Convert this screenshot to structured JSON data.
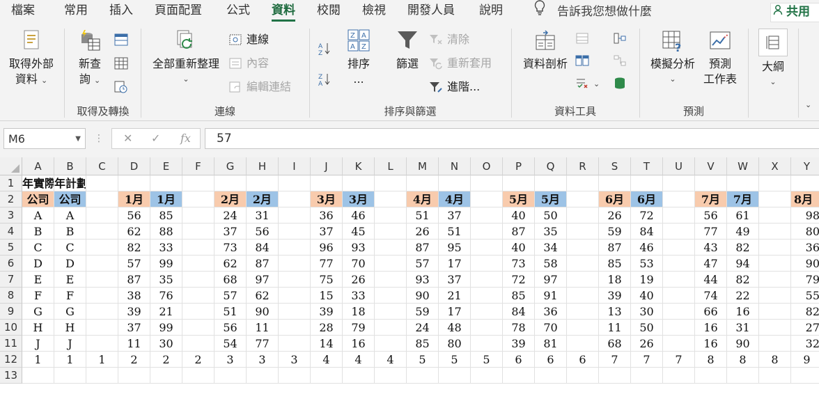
{
  "tabs": [
    "檔案",
    "常用",
    "插入",
    "頁面配置",
    "公式",
    "資料",
    "校閱",
    "檢視",
    "開發人員",
    "說明"
  ],
  "active_tab": "資料",
  "tell_me": "告訴我您想做什麼",
  "share_label": "共用",
  "ribbon": {
    "get_external": {
      "line1": "取得外部",
      "line2": "資料"
    },
    "new_query": {
      "line1": "新查",
      "line2": "詢"
    },
    "group_get_transform": "取得及轉換",
    "refresh_all": "全部重新整理",
    "connections": "連線",
    "properties": "內容",
    "edit_links": "編輯連結",
    "group_connections": "連線",
    "sort": "排序",
    "sort_more": "...",
    "filter": "篩選",
    "clear": "清除",
    "reapply": "重新套用",
    "advanced": "進階...",
    "group_sort_filter": "排序與篩選",
    "data_analysis": "資料剖析",
    "group_data_tools": "資料工具",
    "what_if": "模擬分析",
    "forecast_sheet": {
      "line1": "預測",
      "line2": "工作表"
    },
    "group_forecast": "預測",
    "outline": "大綱"
  },
  "formula_bar": {
    "name_box": "M6",
    "formula": "57",
    "fx": "fx"
  },
  "colors": {
    "accent_green": "#217346",
    "orange_header": "#f8cbad",
    "blue_header": "#9dc3e6"
  },
  "grid": {
    "columns": [
      "A",
      "B",
      "C",
      "D",
      "E",
      "F",
      "G",
      "H",
      "I",
      "J",
      "K",
      "L",
      "M",
      "N",
      "O",
      "P",
      "Q",
      "R",
      "S",
      "T",
      "U",
      "V",
      "W",
      "X",
      "Y"
    ],
    "row_numbers": [
      "1",
      "2",
      "3",
      "4",
      "5",
      "6",
      "7",
      "8",
      "9",
      "10",
      "11",
      "12",
      "13"
    ],
    "row1": {
      "A": "年實際",
      "B": "年計劃"
    },
    "company_headers": [
      "公司",
      "公司"
    ],
    "month_headers": [
      {
        "left": "1月",
        "right": "1月"
      },
      {
        "left": "2月",
        "right": "2月"
      },
      {
        "left": "3月",
        "right": "3月"
      },
      {
        "left": "4月",
        "right": "4月"
      },
      {
        "left": "5月",
        "right": "5月"
      },
      {
        "left": "6月",
        "right": "6月"
      },
      {
        "left": "7月",
        "right": "7月"
      },
      {
        "left": "8月",
        "right": ""
      }
    ],
    "companies": [
      "A",
      "B",
      "C",
      "D",
      "E",
      "F",
      "G",
      "H",
      "J"
    ],
    "values": [
      [
        56,
        85,
        24,
        31,
        36,
        46,
        51,
        37,
        40,
        50,
        26,
        72,
        56,
        61,
        98
      ],
      [
        62,
        88,
        37,
        56,
        37,
        45,
        26,
        51,
        87,
        35,
        59,
        84,
        77,
        49,
        80
      ],
      [
        82,
        33,
        73,
        84,
        96,
        93,
        87,
        95,
        40,
        34,
        87,
        46,
        43,
        82,
        36
      ],
      [
        57,
        99,
        62,
        87,
        77,
        70,
        57,
        17,
        73,
        58,
        85,
        53,
        47,
        94,
        90
      ],
      [
        87,
        35,
        68,
        97,
        75,
        26,
        93,
        37,
        72,
        97,
        18,
        19,
        44,
        82,
        79
      ],
      [
        38,
        76,
        57,
        62,
        15,
        33,
        90,
        21,
        85,
        91,
        39,
        40,
        74,
        22,
        55
      ],
      [
        39,
        21,
        51,
        90,
        39,
        18,
        59,
        17,
        84,
        36,
        13,
        30,
        66,
        16,
        82
      ],
      [
        37,
        99,
        56,
        11,
        28,
        79,
        24,
        48,
        78,
        70,
        11,
        50,
        16,
        31,
        27
      ],
      [
        11,
        30,
        54,
        77,
        14,
        16,
        85,
        80,
        39,
        81,
        68,
        26,
        16,
        90,
        32
      ]
    ],
    "row12": [
      "1",
      "1",
      "1",
      "2",
      "2",
      "2",
      "3",
      "3",
      "3",
      "4",
      "4",
      "4",
      "5",
      "5",
      "5",
      "6",
      "6",
      "6",
      "7",
      "7",
      "7",
      "8",
      "8",
      "8",
      "9"
    ]
  }
}
